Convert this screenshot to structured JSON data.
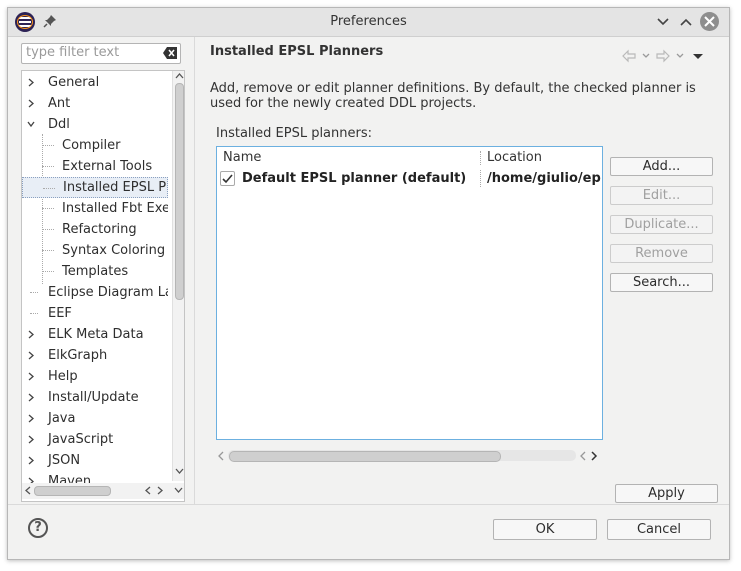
{
  "window": {
    "title": "Preferences"
  },
  "filter": {
    "placeholder": "type filter text"
  },
  "tree": {
    "items": [
      {
        "label": "General",
        "arrow": "›"
      },
      {
        "label": "Ant",
        "arrow": "›"
      },
      {
        "label": "Ddl",
        "arrow": "⌄"
      },
      {
        "label": "Compiler",
        "arrow": ""
      },
      {
        "label": "External Tools",
        "arrow": ""
      },
      {
        "label": "Installed EPSL Pla",
        "arrow": ""
      },
      {
        "label": "Installed Fbt Exec",
        "arrow": ""
      },
      {
        "label": "Refactoring",
        "arrow": ""
      },
      {
        "label": "Syntax Coloring",
        "arrow": ""
      },
      {
        "label": "Templates",
        "arrow": ""
      },
      {
        "label": "Eclipse Diagram La",
        "arrow": ""
      },
      {
        "label": "EEF",
        "arrow": ""
      },
      {
        "label": "ELK Meta Data",
        "arrow": "›"
      },
      {
        "label": "ElkGraph",
        "arrow": "›"
      },
      {
        "label": "Help",
        "arrow": "›"
      },
      {
        "label": "Install/Update",
        "arrow": "›"
      },
      {
        "label": "Java",
        "arrow": "›"
      },
      {
        "label": "JavaScript",
        "arrow": "›"
      },
      {
        "label": "JSON",
        "arrow": "›"
      },
      {
        "label": "Maven",
        "arrow": "›"
      }
    ],
    "selected_index": 5
  },
  "page": {
    "title": "Installed EPSL Planners",
    "description": "Add, remove or edit planner definitions. By default, the checked planner is used for the newly created DDL projects.",
    "table_label": "Installed EPSL planners:",
    "columns": {
      "name": "Name",
      "location": "Location"
    },
    "rows": [
      {
        "checked": true,
        "name": "Default EPSL planner (default)",
        "location": "/home/giulio/ep"
      }
    ]
  },
  "buttons": {
    "add": "Add...",
    "edit": "Edit...",
    "duplicate": "Duplicate...",
    "remove": "Remove",
    "search": "Search...",
    "apply": "Apply",
    "ok": "OK",
    "cancel": "Cancel"
  },
  "colors": {
    "table_border": "#6cb0e0",
    "selection": "#e8eef6"
  }
}
